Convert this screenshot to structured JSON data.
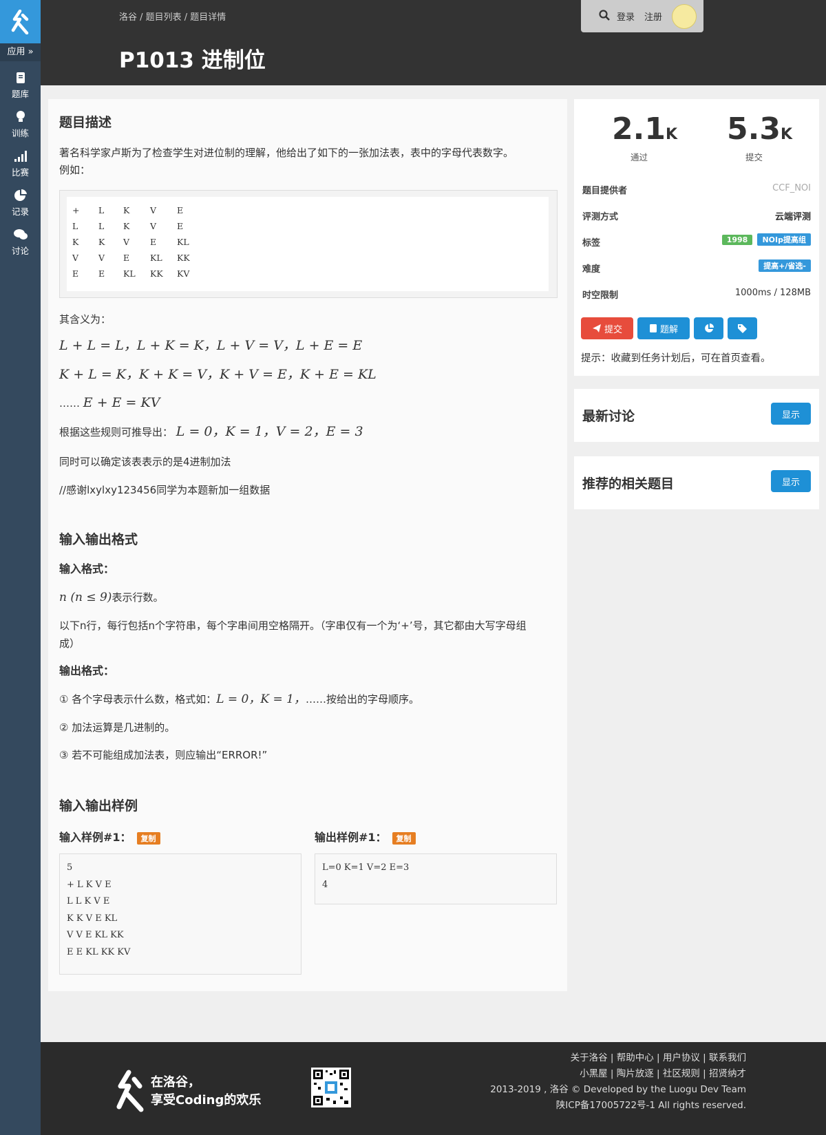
{
  "sidebar": {
    "app_label": "应用 »",
    "items": [
      {
        "label": "题库",
        "icon": "book-icon"
      },
      {
        "label": "训练",
        "icon": "lightbulb-icon"
      },
      {
        "label": "比赛",
        "icon": "signal-icon"
      },
      {
        "label": "记录",
        "icon": "pie-chart-icon"
      },
      {
        "label": "讨论",
        "icon": "chat-icon"
      }
    ]
  },
  "header": {
    "breadcrumb": "洛谷 / 题目列表 / 题目详情",
    "title": "P1013 进制位",
    "login": "登录",
    "register": "注册"
  },
  "problem": {
    "desc_title": "题目描述",
    "desc_p1": "著名科学家卢斯为了检查学生对进位制的理解，他给出了如下的一张加法表，表中的字母代表数字。",
    "desc_p2": "例如：",
    "table": [
      [
        "+",
        "L",
        "K",
        "V",
        "E"
      ],
      [
        "L",
        "L",
        "K",
        "V",
        "E"
      ],
      [
        "K",
        "K",
        "V",
        "E",
        "KL"
      ],
      [
        "V",
        "V",
        "E",
        "KL",
        "KK"
      ],
      [
        "E",
        "E",
        "KL",
        "KK",
        "KV"
      ]
    ],
    "meaning": "其含义为：",
    "eq1": "L + L = L，L + K = K，L + V = V，L + E = E",
    "eq2": "K + L = K，K + K = V，K + V = E，K + E = KL",
    "eq3_prefix": "……",
    "eq3": "E + E = KV",
    "derive_prefix": "根据这些规则可推导出：",
    "derive": "L = 0，K = 1，V = 2，E = 3",
    "base_note": "同时可以确定该表表示的是4进制加法",
    "thanks": "//感谢lxylxy123456同学为本题新加一组数据",
    "io_title": "输入输出格式",
    "input_label": "输入格式：",
    "input_p1_math": "n (n ≤ 9)",
    "input_p1_text": "表示行数。",
    "input_p2": "以下n行，每行包括n个字符串，每个字串间用空格隔开。（字串仅有一个为‘+’号，其它都由大写字母组成）",
    "output_label": "输出格式：",
    "out1_prefix": "① 各个字母表示什么数，格式如：",
    "out1_math": "L = 0，K = 1，",
    "out1_suffix": "……按给出的字母顺序。",
    "out2": "② 加法运算是几进制的。",
    "out3": "③ 若不可能组成加法表，则应输出“ERROR!”",
    "sample_title": "输入输出样例",
    "sample_in_label": "输入样例#1：",
    "sample_out_label": "输出样例#1：",
    "copy": "复制",
    "sample_in": [
      "5",
      "+ L K V E",
      "L L K V E",
      "K K V E KL",
      "V V E KL KK",
      "E E KL KK KV"
    ],
    "sample_out": [
      "L=0 K=1 V=2 E=3",
      "4"
    ]
  },
  "stats": {
    "passed": "2.1",
    "passed_unit": "K",
    "passed_label": "通过",
    "submitted": "5.3",
    "submitted_unit": "K",
    "submitted_label": "提交"
  },
  "info": {
    "provider_k": "题目提供者",
    "provider_v": "CCF_NOI",
    "judge_k": "评测方式",
    "judge_v": "云端评测",
    "tags_k": "标签",
    "tag1": "1998",
    "tag2": "NOIp提高组",
    "diff_k": "难度",
    "diff_v": "提高+/省选-",
    "limit_k": "时空限制",
    "limit_v": "1000ms / 128MB"
  },
  "actions": {
    "submit": "提交",
    "solution": "题解",
    "hint": "提示：收藏到任务计划后，可在首页查看。"
  },
  "panels": {
    "discuss": "最新讨论",
    "related": "推荐的相关题目",
    "show": "显示"
  },
  "footer": {
    "slogan1": "在洛谷，",
    "slogan2": "享受Coding的欢乐",
    "links1": "关于洛谷 | 帮助中心 | 用户协议 | 联系我们",
    "links2": "小黑屋 | 陶片放逐 | 社区规则 | 招贤纳才",
    "copyright": "2013-2019 , 洛谷 © Developed by the Luogu Dev Team",
    "icp": "陕ICP备17005722号-1 All rights reserved."
  },
  "colors": {
    "sidebar": "#34495e",
    "logo": "#3498db",
    "red": "#e74c3c",
    "blue": "#1e90d6",
    "green": "#5cb85c",
    "orange": "#e67e22"
  }
}
